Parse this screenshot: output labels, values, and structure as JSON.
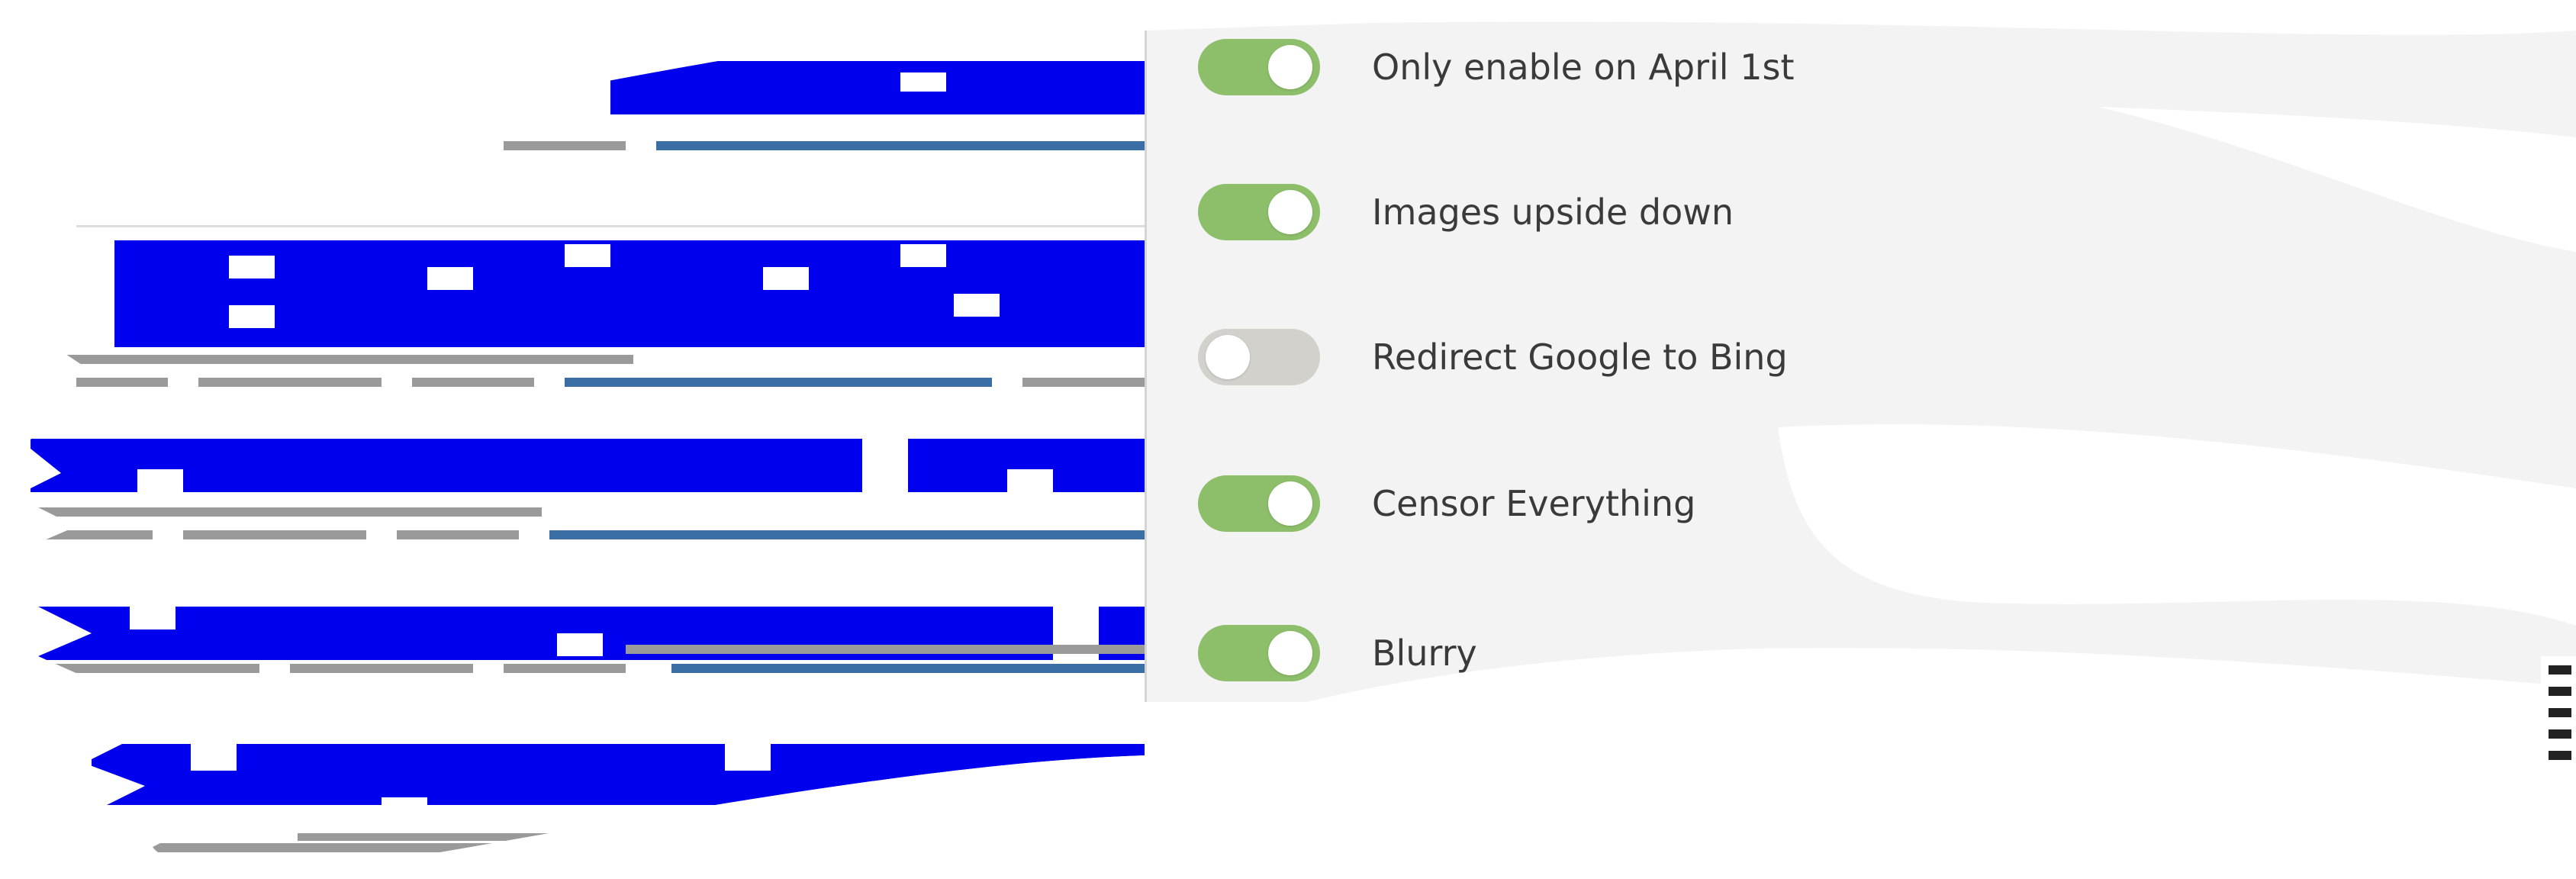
{
  "settings": {
    "toggles": [
      {
        "label": "Only enable on April 1st",
        "enabled": true
      },
      {
        "label": "Images upside down",
        "enabled": true
      },
      {
        "label": "Redirect Google to Bing",
        "enabled": false
      },
      {
        "label": "Censor Everything",
        "enabled": true
      },
      {
        "label": "Blurry",
        "enabled": true
      }
    ]
  },
  "colors": {
    "toggle_on": "#8dbf6a",
    "toggle_off": "#d3d1cb",
    "censor_bar": "#0000ee",
    "gray_line": "#9a9a9a",
    "blue_line": "#3a6ea5"
  }
}
